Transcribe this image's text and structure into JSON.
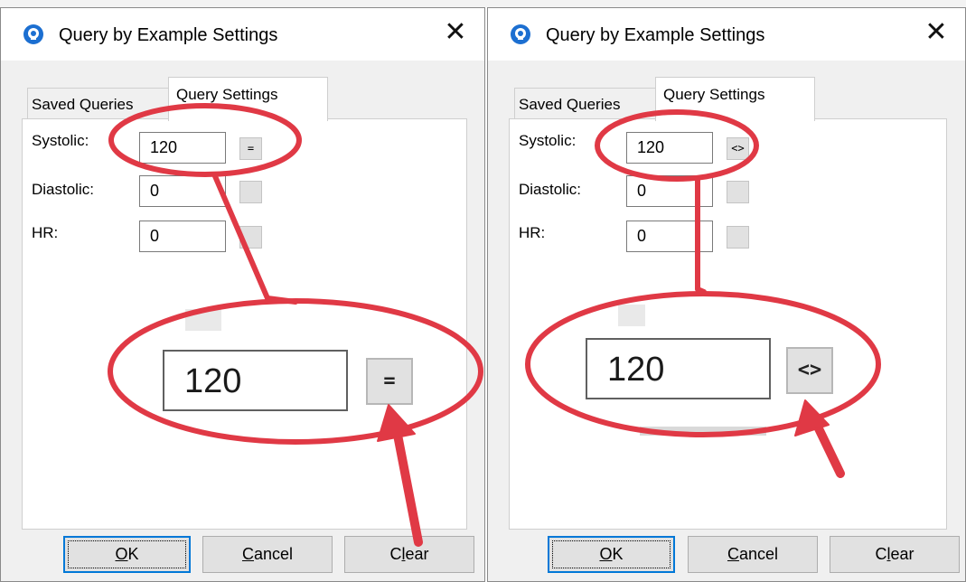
{
  "accent_color": "#0078d7",
  "annotation_color": "#e03945",
  "dialogs": [
    {
      "title": "Query by Example Settings",
      "close_glyph": "✕",
      "tabs": {
        "saved": "Saved Queries",
        "active": "Query Settings"
      },
      "fields": [
        {
          "label": "Systolic:",
          "value": "120",
          "operator": "="
        },
        {
          "label": "Diastolic:",
          "value": "0",
          "operator": ""
        },
        {
          "label": "HR:",
          "value": "0",
          "operator": ""
        }
      ],
      "zoom": {
        "value": "120",
        "operator": "="
      },
      "buttons": {
        "ok": {
          "mnemonic": "O",
          "rest": "K"
        },
        "cancel": {
          "mnemonic": "C",
          "rest": "ancel"
        },
        "clear": {
          "pre": "C",
          "mnemonic": "l",
          "rest": "ear"
        }
      }
    },
    {
      "title": "Query by Example Settings",
      "close_glyph": "✕",
      "tabs": {
        "saved": "Saved Queries",
        "active": "Query Settings"
      },
      "fields": [
        {
          "label": "Systolic:",
          "value": "120",
          "operator": "<>"
        },
        {
          "label": "Diastolic:",
          "value": "0",
          "operator": ""
        },
        {
          "label": "HR:",
          "value": "0",
          "operator": ""
        }
      ],
      "zoom": {
        "value": "120",
        "operator": "<>"
      },
      "buttons": {
        "ok": {
          "mnemonic": "O",
          "rest": "K"
        },
        "cancel": {
          "mnemonic": "C",
          "rest": "ancel"
        },
        "clear": {
          "pre": "C",
          "mnemonic": "l",
          "rest": "ear"
        }
      }
    }
  ]
}
